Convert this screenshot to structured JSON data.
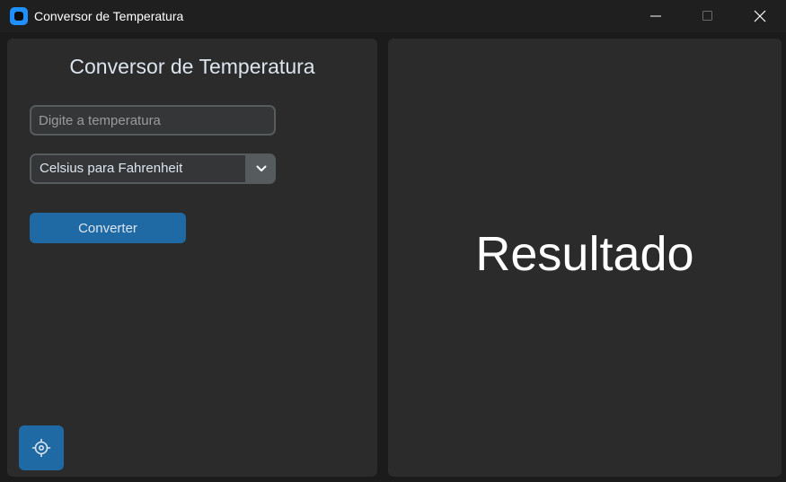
{
  "window": {
    "title": "Conversor de Temperatura",
    "icons": {
      "app": "app-icon",
      "minimize": "minimize-icon",
      "maximize": "maximize-icon",
      "close": "close-icon"
    }
  },
  "left_panel": {
    "title": "Conversor de Temperatura",
    "temperature_input": {
      "value": "",
      "placeholder": "Digite a temperatura"
    },
    "conversion_select": {
      "selected": "Celsius para Fahrenheit",
      "icon": "chevron-down-icon"
    },
    "convert_button": {
      "label": "Converter"
    },
    "settings_button": {
      "icon": "gear-icon"
    }
  },
  "right_panel": {
    "result": "Resultado"
  },
  "colors": {
    "accent": "#1f6aa5",
    "panel_bg": "#2b2b2b",
    "window_bg": "#1b1b1b",
    "text": "#dce4ee",
    "app_icon": "#1e90ff"
  }
}
